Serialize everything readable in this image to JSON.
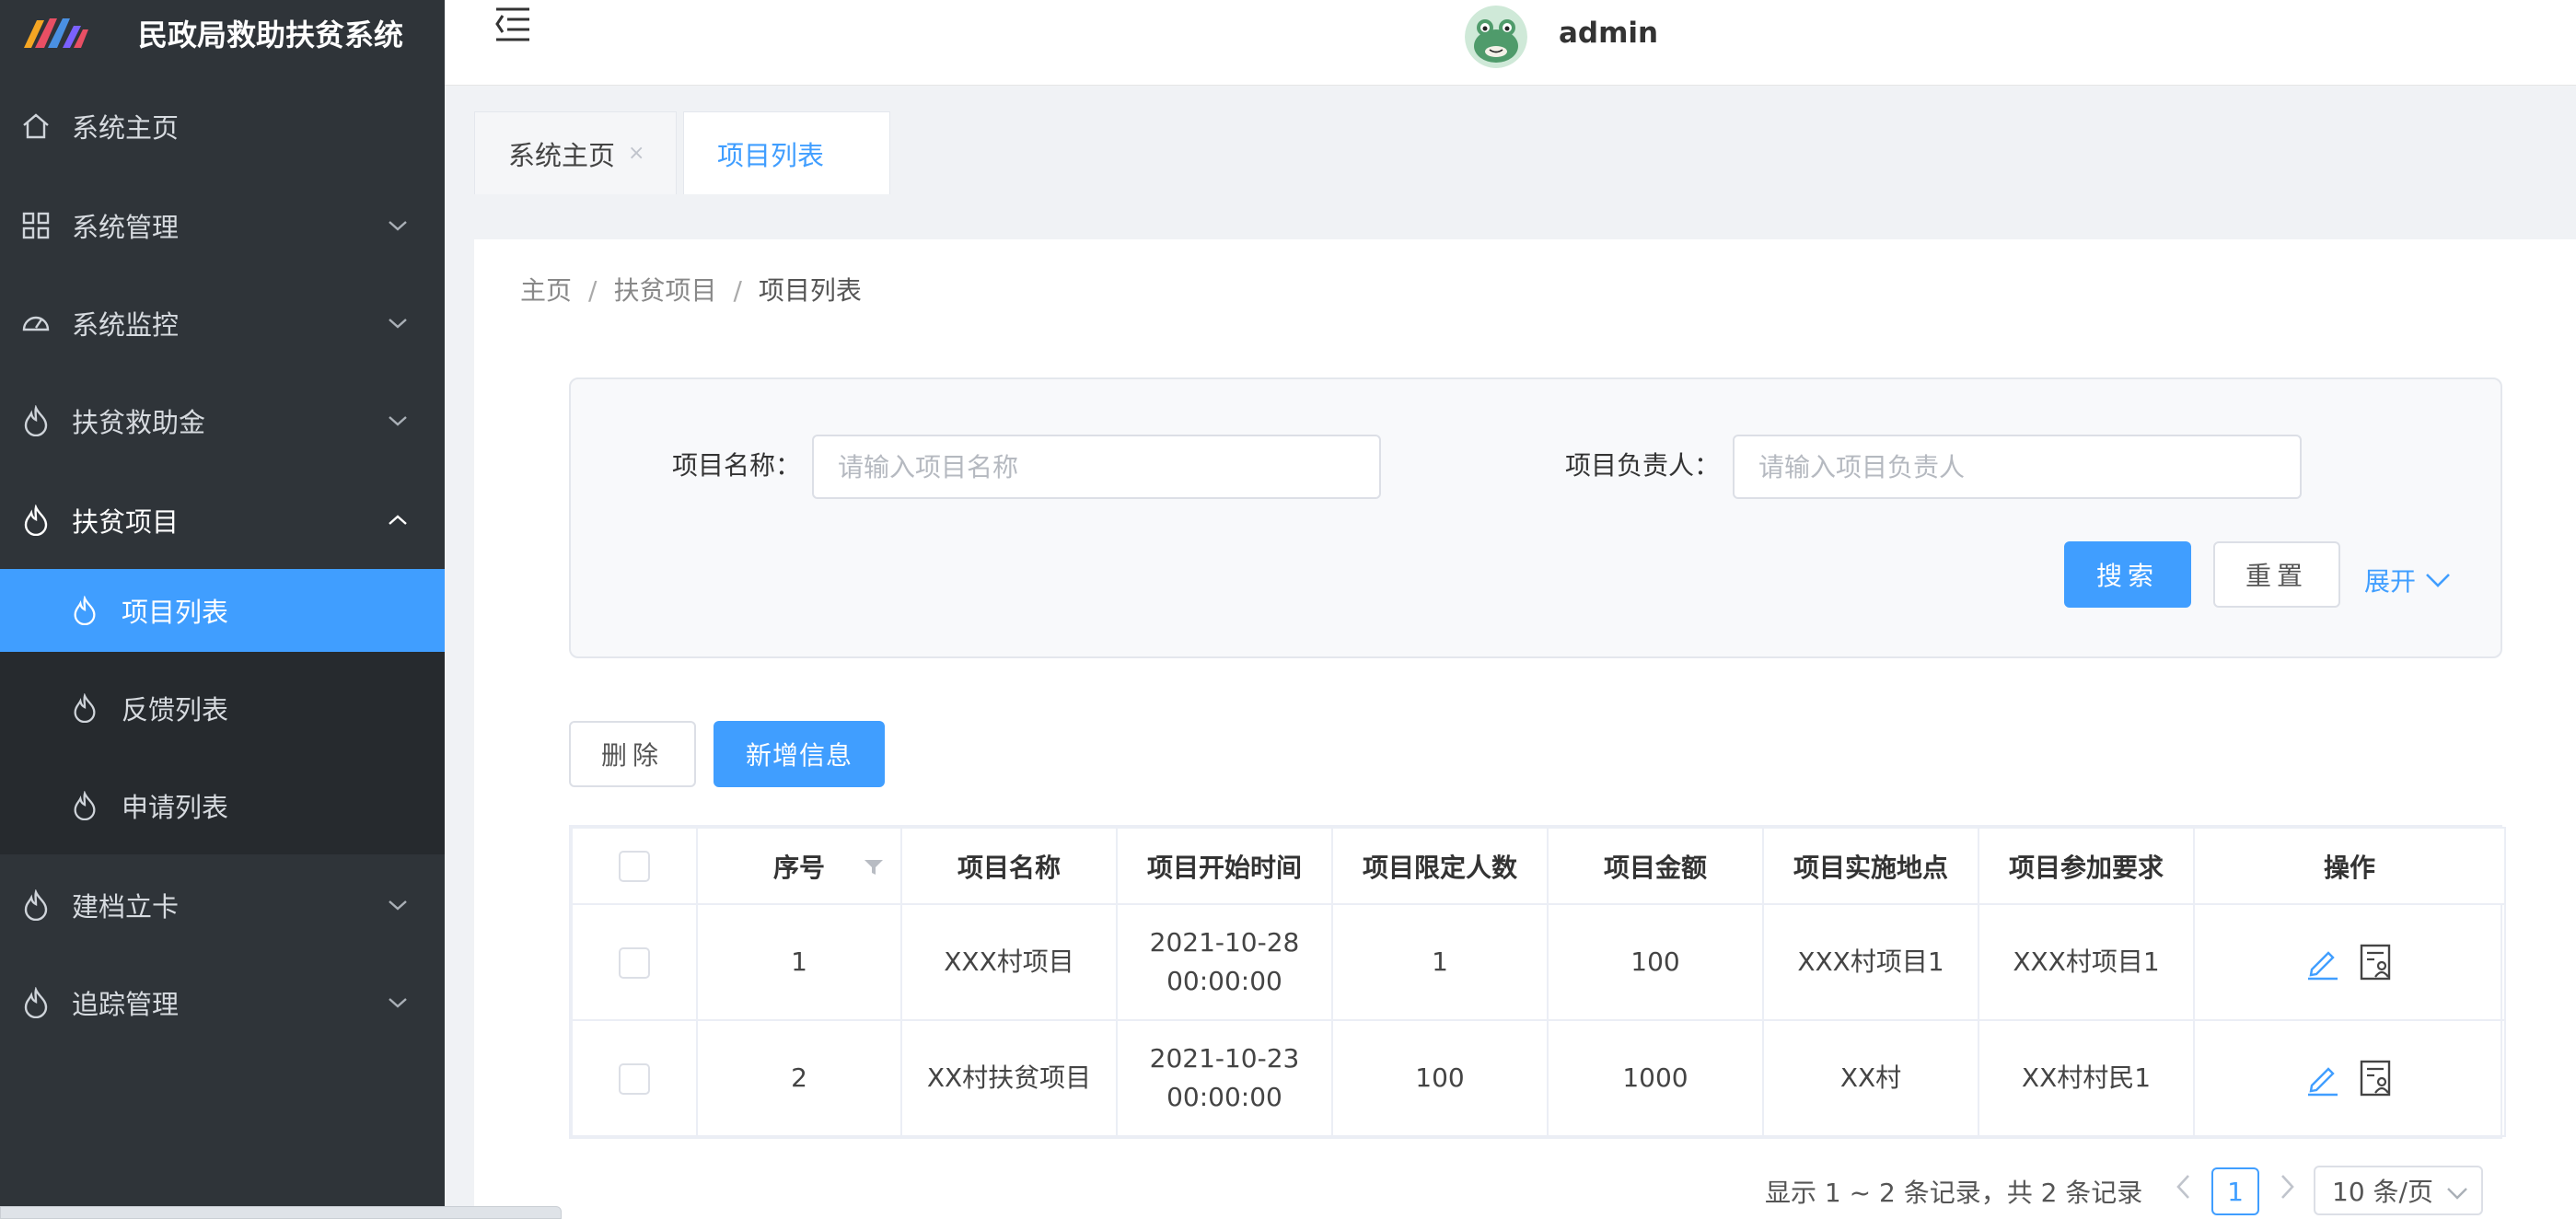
{
  "app": {
    "title": "民政局救助扶贫系统",
    "username": "admin"
  },
  "sidebar": {
    "items": [
      {
        "label": "系统主页",
        "icon": "home-icon"
      },
      {
        "label": "系统管理",
        "icon": "grid-icon"
      },
      {
        "label": "系统监控",
        "icon": "dashboard-icon"
      },
      {
        "label": "扶贫救助金",
        "icon": "flame-icon"
      },
      {
        "label": "扶贫项目",
        "icon": "flame-icon",
        "expanded": true
      },
      {
        "label": "建档立卡",
        "icon": "flame-icon"
      },
      {
        "label": "追踪管理",
        "icon": "flame-icon"
      }
    ],
    "subitems": [
      {
        "label": "项目列表",
        "active": true
      },
      {
        "label": "反馈列表"
      },
      {
        "label": "申请列表"
      }
    ]
  },
  "tabs": [
    {
      "label": "系统主页",
      "close": "×"
    },
    {
      "label": "项目列表",
      "active": true
    }
  ],
  "breadcrumb": {
    "items": [
      "主页",
      "扶贫项目",
      "项目列表"
    ],
    "separator": "/"
  },
  "search": {
    "name_label": "项目名称：",
    "name_placeholder": "请输入项目名称",
    "leader_label": "项目负责人：",
    "leader_placeholder": "请输入项目负责人",
    "search_button": "搜索",
    "reset_button": "重置",
    "expand_link": "展开"
  },
  "toolbar": {
    "delete_button": "删除",
    "add_button": "新增信息"
  },
  "table": {
    "columns": [
      "序号",
      "项目名称",
      "项目开始时间",
      "项目限定人数",
      "项目金额",
      "项目实施地点",
      "项目参加要求",
      "操作"
    ],
    "rows": [
      {
        "seq": "1",
        "name": "XXX村项目",
        "start_date": "2021-10-28",
        "start_time": "00:00:00",
        "limit": "1",
        "amount": "100",
        "location": "XXX村项目1",
        "requirement": "XXX村项目1"
      },
      {
        "seq": "2",
        "name": "XX村扶贫项目",
        "start_date": "2021-10-23",
        "start_time": "00:00:00",
        "limit": "100",
        "amount": "1000",
        "location": "XX村",
        "requirement": "XX村村民1"
      }
    ]
  },
  "pagination": {
    "total_text": "显示 1 ~ 2 条记录，共 2 条记录",
    "current_page": "1",
    "page_size": "10 条/页"
  },
  "colors": {
    "primary": "#409eff",
    "sidebar_bg": "#2f3439"
  }
}
